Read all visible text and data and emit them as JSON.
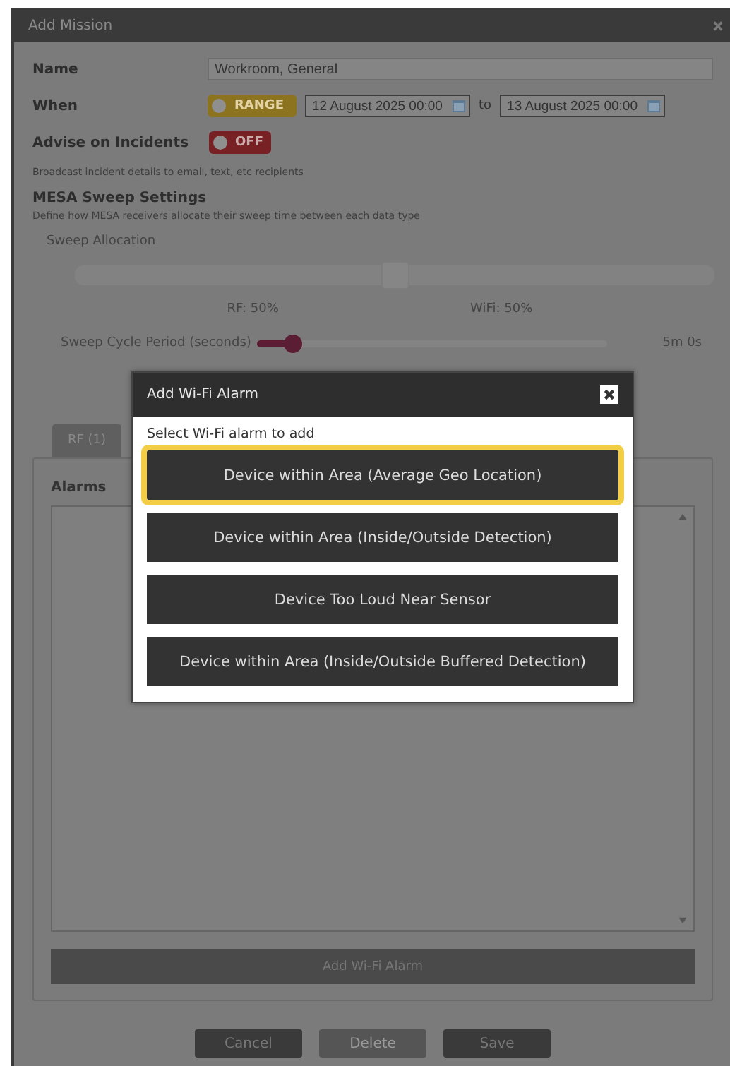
{
  "window": {
    "title": "Add Mission"
  },
  "form": {
    "name": {
      "label": "Name",
      "value": "Workroom, General"
    },
    "when": {
      "label": "When",
      "toggle": {
        "label": "RANGE",
        "on": true
      },
      "start": "12 August 2025 00:00",
      "separator": "to",
      "end": "13 August 2025 00:00"
    },
    "advise": {
      "label": "Advise on Incidents",
      "toggle": {
        "label": "OFF",
        "on": false
      },
      "hint": "Broadcast incident details to email, text, etc recipients"
    }
  },
  "sweep": {
    "title": "MESA Sweep Settings",
    "hint": "Define how MESA receivers allocate their sweep time between each data type",
    "allocation": {
      "label": "Sweep Allocation",
      "level": 0.5,
      "rf": "RF: 50%",
      "wifi": "WiFi: 50%"
    },
    "cycle": {
      "label": "Sweep Cycle Period (seconds)",
      "level": 0.1,
      "reading": "5m 0s"
    }
  },
  "tabs": [
    {
      "label": "RF (1)",
      "selected": false
    }
  ],
  "alarms": {
    "label": "Alarms",
    "add_button": "Add Wi-Fi Alarm"
  },
  "buttons": [
    {
      "label": "Cancel",
      "disabled": false
    },
    {
      "label": "Delete",
      "disabled": true
    },
    {
      "label": "Save",
      "disabled": false
    }
  ],
  "modal": {
    "title": "Add Wi-Fi Alarm",
    "prompt": "Select Wi-Fi alarm to add",
    "options": [
      {
        "label": "Device within Area (Average Geo Location)",
        "selected": true
      },
      {
        "label": "Device within Area (Inside/Outside Detection)",
        "selected": false
      },
      {
        "label": "Device Too Loud Near Sensor",
        "selected": false
      },
      {
        "label": "Device within Area (Inside/Outside Buffered Detection)",
        "selected": false
      }
    ]
  }
}
